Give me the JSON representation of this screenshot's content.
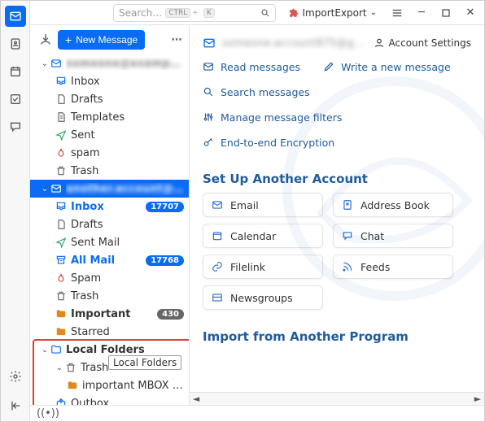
{
  "search": {
    "placeholder": "Search…",
    "kbd1": "CTRL",
    "kbd2": "K"
  },
  "plugin": {
    "name": "ImportExport"
  },
  "new_message": "New Message",
  "accounts": [
    {
      "name": "account-1",
      "blurred": true,
      "folders": [
        {
          "key": "inbox",
          "label": "Inbox",
          "icon": "inbox",
          "color": "blue"
        },
        {
          "key": "drafts",
          "label": "Drafts",
          "icon": "doc",
          "color": ""
        },
        {
          "key": "templates",
          "label": "Templates",
          "icon": "doc",
          "color": ""
        },
        {
          "key": "sent",
          "label": "Sent",
          "icon": "sent",
          "color": "green"
        },
        {
          "key": "spam",
          "label": "spam",
          "icon": "flame",
          "color": "red"
        },
        {
          "key": "trash",
          "label": "Trash",
          "icon": "trash",
          "color": ""
        }
      ]
    },
    {
      "name": "account-2",
      "blurred": true,
      "selected": true,
      "folders": [
        {
          "key": "inbox",
          "label": "Inbox",
          "icon": "inbox",
          "color": "blue",
          "bold": true,
          "badge": "17707"
        },
        {
          "key": "drafts",
          "label": "Drafts",
          "icon": "doc",
          "color": ""
        },
        {
          "key": "sentmail",
          "label": "Sent Mail",
          "icon": "sent",
          "color": "green"
        },
        {
          "key": "allmail",
          "label": "All Mail",
          "icon": "archive",
          "color": "blue",
          "bold": true,
          "badge": "17768"
        },
        {
          "key": "spam",
          "label": "Spam",
          "icon": "flame",
          "color": "red"
        },
        {
          "key": "trash",
          "label": "Trash",
          "icon": "trash",
          "color": ""
        },
        {
          "key": "important",
          "label": "Important",
          "icon": "folder",
          "color": "orange",
          "bold": true,
          "badge": "430",
          "badge_grey": true
        },
        {
          "key": "starred",
          "label": "Starred",
          "icon": "folder",
          "color": "orange"
        }
      ]
    }
  ],
  "local_folders": {
    "label": "Local Folders",
    "trash": "Trash",
    "tooltip": "Local Folders",
    "mbox": "important MBOX file",
    "outbox": "Outbox"
  },
  "account_settings": "Account Settings",
  "quick_actions": {
    "read": "Read messages",
    "write": "Write a new message",
    "search": "Search messages",
    "filters": "Manage message filters",
    "e2e": "End-to-end Encryption"
  },
  "setup": {
    "heading": "Set Up Another Account",
    "email": "Email",
    "addressbook": "Address Book",
    "calendar": "Calendar",
    "chat": "Chat",
    "filelink": "Filelink",
    "feeds": "Feeds",
    "newsgroups": "Newsgroups"
  },
  "import_heading": "Import from Another Program",
  "status_icon": "((•))"
}
